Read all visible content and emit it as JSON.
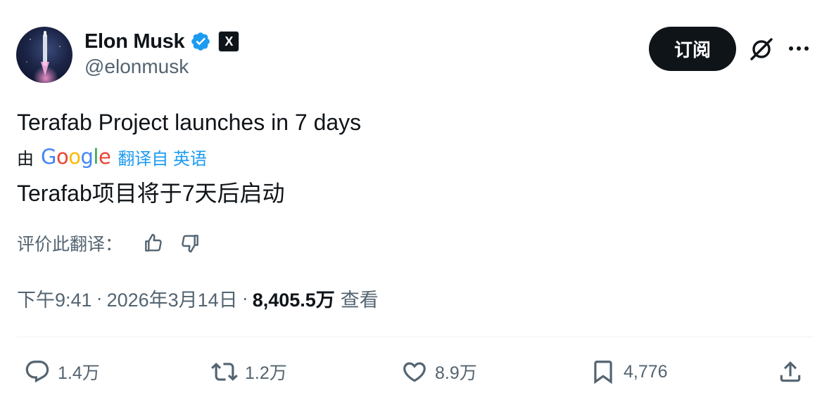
{
  "author": {
    "display_name": "Elon Musk",
    "handle": "@elonmusk",
    "verified": true,
    "affiliate_badge": "X"
  },
  "header": {
    "subscribe_label": "订阅"
  },
  "tweet": {
    "text": "Terafab Project launches in 7 days"
  },
  "translation": {
    "by_label": "由",
    "provider_logo_text": "Google",
    "link_label": "翻译自 英语",
    "translated_text": "Terafab项目将于7天后启动",
    "rate_label": "评价此翻译："
  },
  "meta": {
    "time": "下午9:41",
    "separator": "·",
    "date": "2026年3月14日",
    "views_count": "8,405.5万",
    "views_label": "查看"
  },
  "actions": {
    "replies": "1.4万",
    "retweets": "1.2万",
    "likes": "8.9万",
    "bookmarks": "4,776"
  },
  "colors": {
    "text_primary": "#0f1419",
    "text_secondary": "#536471",
    "accent_blue": "#1d9bf0",
    "button_dark": "#0f1419"
  },
  "icons": {
    "verified": "verified-badge-icon",
    "grok": "grok-icon",
    "more": "more-horizontal-icon",
    "reply": "reply-icon",
    "retweet": "retweet-icon",
    "like": "heart-icon",
    "bookmark": "bookmark-icon",
    "share": "share-icon"
  }
}
